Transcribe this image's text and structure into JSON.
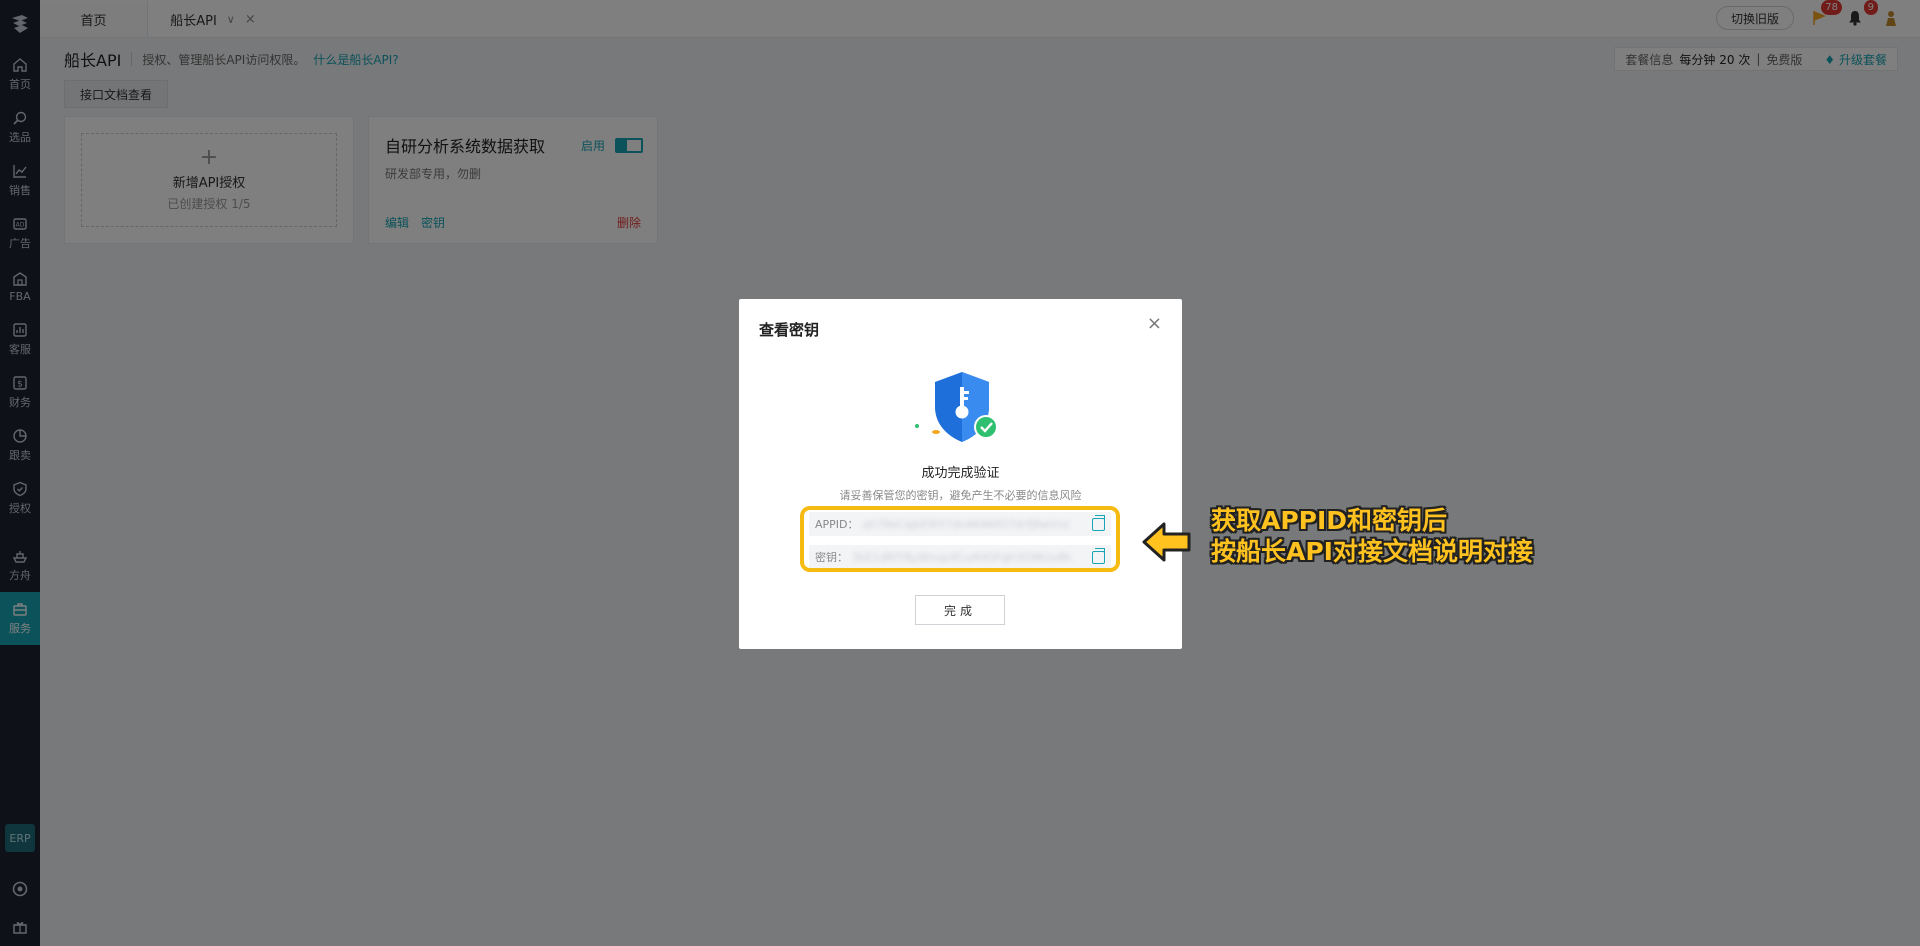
{
  "sidebar": {
    "items": [
      {
        "label": "首页",
        "icon": "home-icon"
      },
      {
        "label": "选品",
        "icon": "search-icon"
      },
      {
        "label": "销售",
        "icon": "chart-line-icon"
      },
      {
        "label": "广告",
        "icon": "ad-icon"
      },
      {
        "label": "FBA",
        "icon": "warehouse-icon"
      },
      {
        "label": "客服",
        "icon": "report-icon"
      },
      {
        "label": "财务",
        "icon": "dollar-icon"
      },
      {
        "label": "跟卖",
        "icon": "pie-chart-icon"
      },
      {
        "label": "授权",
        "icon": "shield-check-icon"
      },
      {
        "label": "方舟",
        "icon": "ship-icon"
      },
      {
        "label": "服务",
        "icon": "service-icon"
      }
    ],
    "erp_label": "ERP"
  },
  "tabs": {
    "home": "首页",
    "api": "船长API"
  },
  "header_right": {
    "switch_old": "切换旧版",
    "flag_badge": "78",
    "bell_badge": "9"
  },
  "page": {
    "title": "船长API",
    "desc": "授权、管理船长API访问权限。",
    "link": "什么是船长API?",
    "doc_button": "接口文档查看",
    "package": {
      "label": "套餐信息",
      "rate": "每分钟 20 次",
      "sep": "|",
      "tier": "免费版",
      "upgrade": "升级套餐"
    }
  },
  "cards": {
    "add": {
      "plus": "+",
      "title": "新增API授权",
      "sub": "已创建授权 1/5"
    },
    "auth": {
      "title": "自研分析系统数据获取",
      "desc": "研发部专用，勿删",
      "status": "启用",
      "edit": "编辑",
      "secret": "密钥",
      "delete": "删除"
    }
  },
  "modal": {
    "title": "查看密钥",
    "close": "×",
    "success_title": "成功完成验证",
    "success_sub": "请妥善保管您的密钥，避免产生不必要的信息风险",
    "appid_label": "APPID：",
    "appid_value": "qh78eCaJkE9i57dnAKA6fO7drfJ8wVnz",
    "key_label": "密钥：",
    "key_value": "3kE1dRfY8yWnopXCuAHGFgh3O9Kzv8h",
    "done": "完成"
  },
  "annotation": {
    "line1": "获取APPID和密钥后",
    "line2": "按船长API对接文档说明对接"
  },
  "colors": {
    "accent": "#18a5b5",
    "sidebar_bg": "#1c2330",
    "highlight": "#f5bb13",
    "danger": "#e53935"
  }
}
